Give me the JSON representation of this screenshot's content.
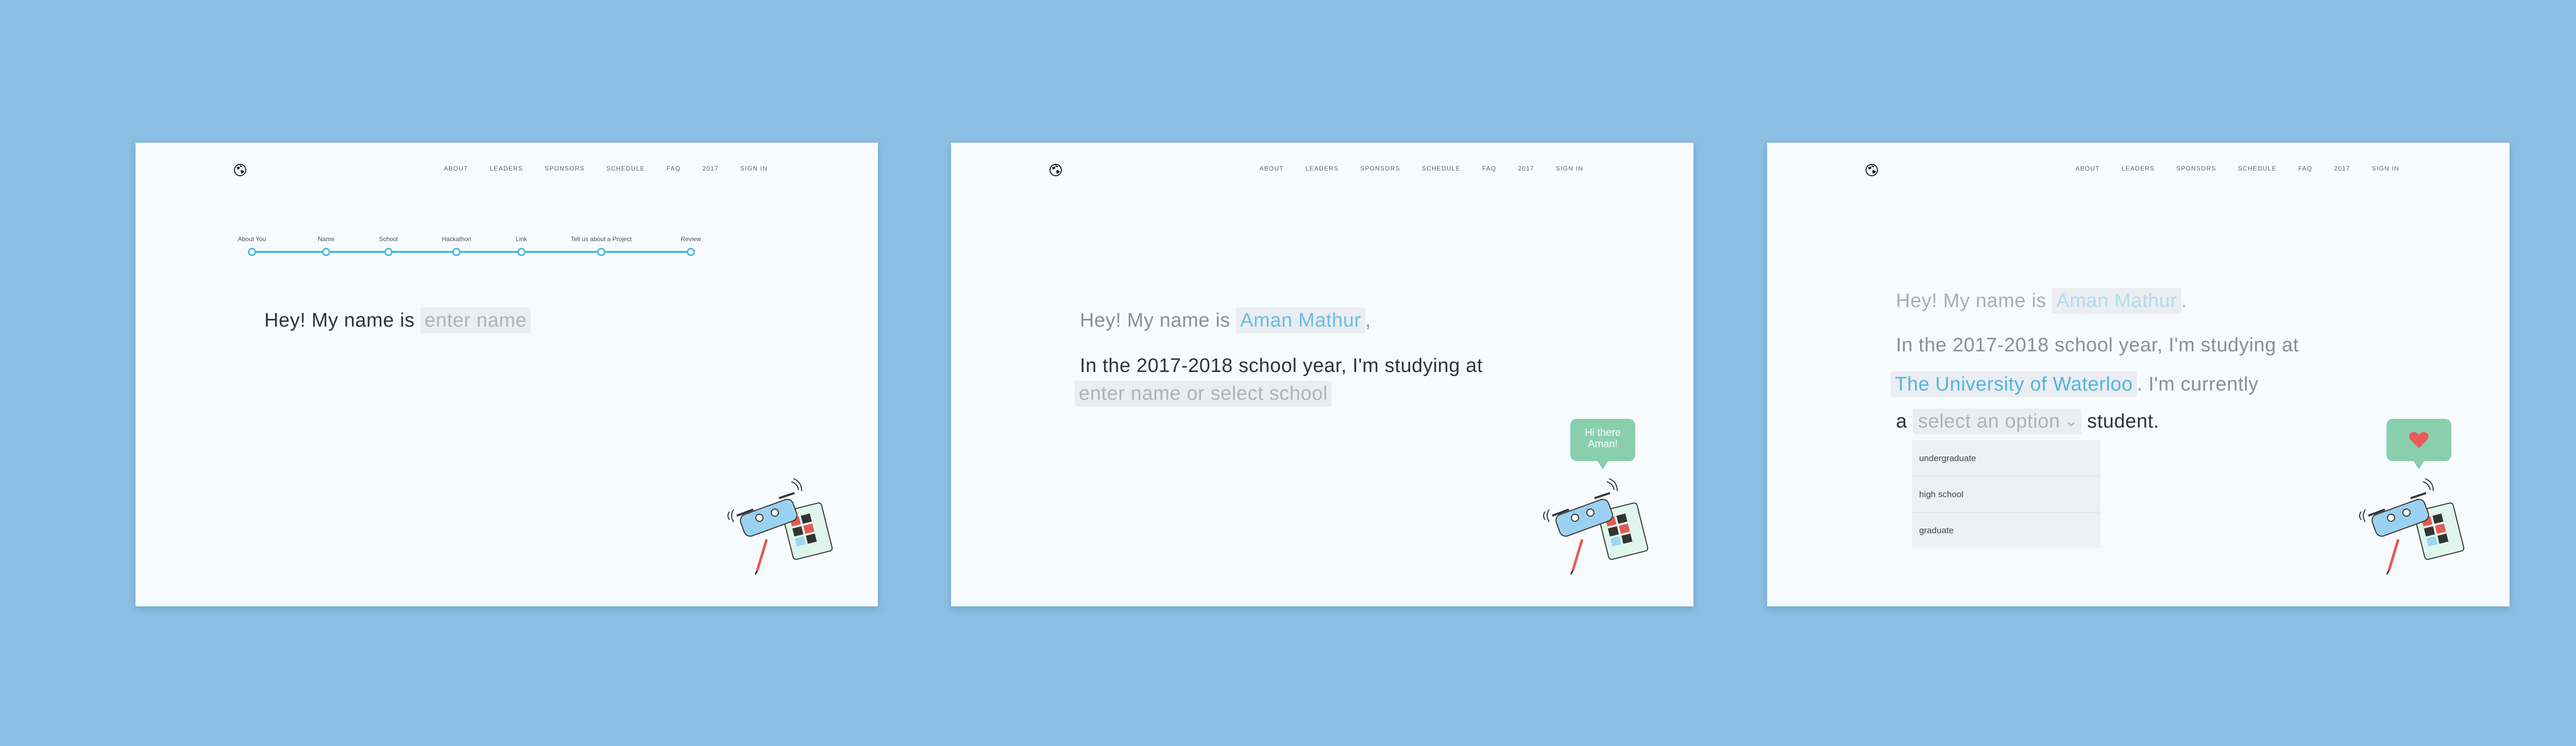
{
  "nav": [
    "ABOUT",
    "LEADERS",
    "SPONSORS",
    "SCHEDULE",
    "FAQ",
    "2017",
    "SIGN IN"
  ],
  "colors": {
    "background": "#8bbfe3",
    "accent": "#4fb6e4",
    "value_text": "#66bfe8",
    "bubble": "#89cfae",
    "heart": "#ea5a5a"
  },
  "icons": [
    "globe-logo-icon",
    "drone-illustration",
    "heart-icon",
    "chevron-down-icon"
  ],
  "panel1": {
    "progress_steps": [
      "About You",
      "Name",
      "School",
      "Hackathon",
      "Link",
      "Tell us about a Project",
      "Review"
    ],
    "greeting": "Hey! My name is",
    "name_placeholder": "enter name"
  },
  "panel2": {
    "greeting": "Hey! My name is",
    "name_value": "Aman Mathur",
    "comma": ",",
    "school_prompt": "In the 2017-2018 school year, I'm studying at",
    "school_placeholder": "enter name or select school",
    "bubble_text": "Hi there Aman!"
  },
  "panel3": {
    "greeting": "Hey! My name is",
    "name_value": "Aman Mathur",
    "period": ".",
    "school_prompt": "In the 2017-2018 school year, I'm studying at",
    "school_value": "The University of Waterloo",
    "currently": ". I'm currently",
    "a_word": "a",
    "select_placeholder": "select an option",
    "student": "student.",
    "options": [
      "undergraduate",
      "high school",
      "graduate"
    ]
  }
}
